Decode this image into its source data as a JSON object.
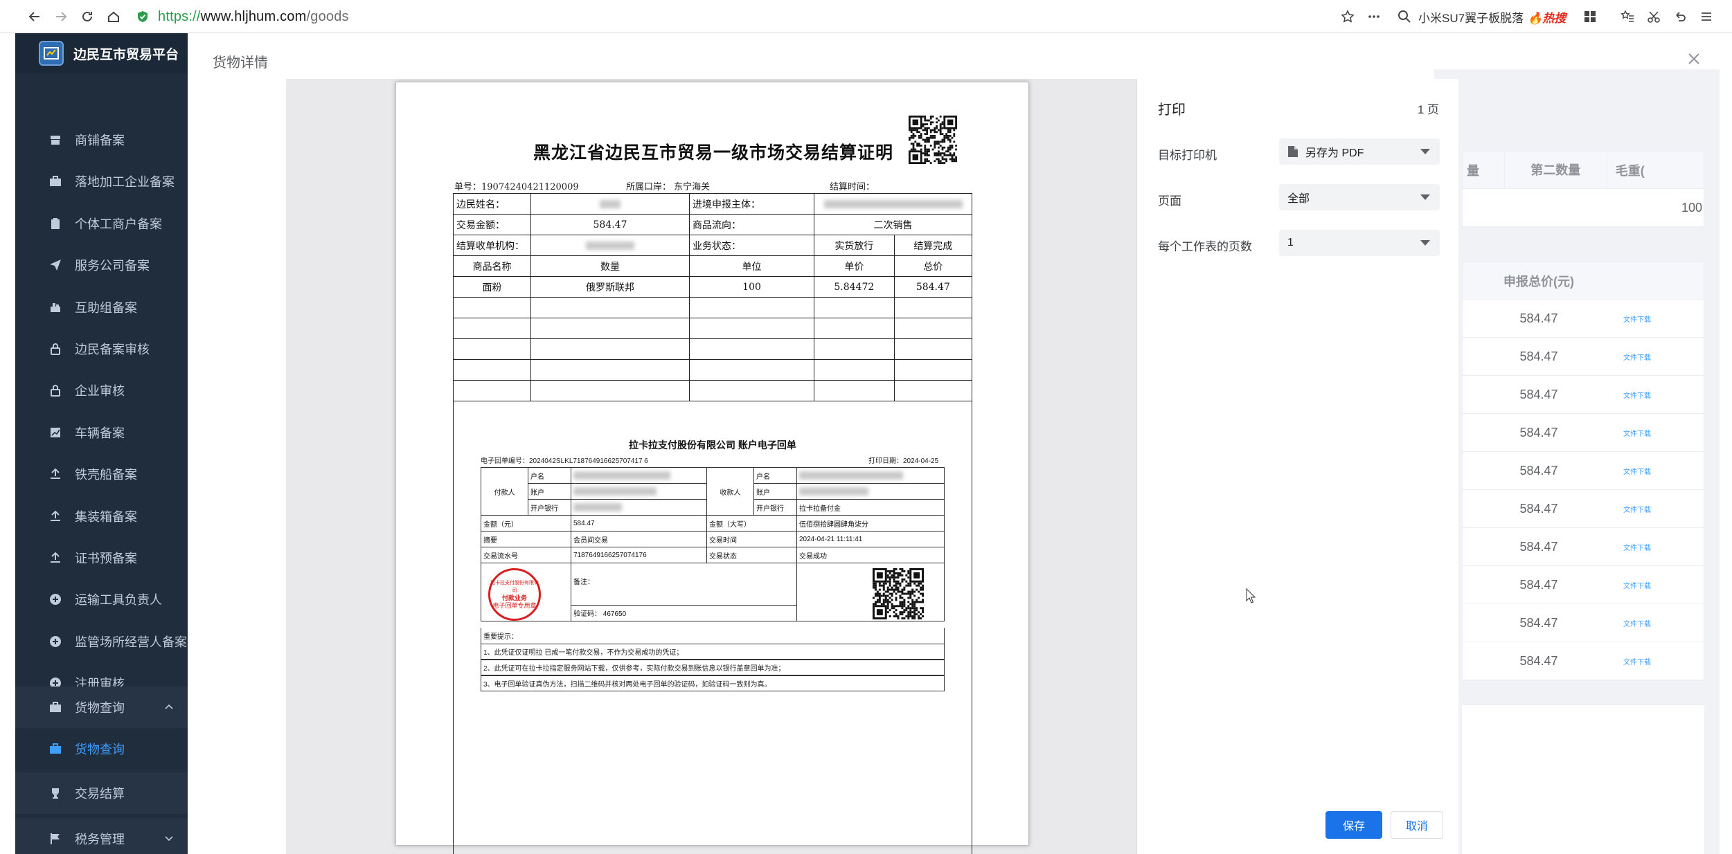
{
  "browser": {
    "url_scheme": "https://",
    "url_host": "www.hljhum.com",
    "url_path": "/goods",
    "search_text": "小米SU7翼子板脱落",
    "search_hot": "热搜"
  },
  "sidebar": {
    "brand": "边民互市贸易平台",
    "items": [
      {
        "label": "商铺备案",
        "icon": "shop-icon"
      },
      {
        "label": "落地加工企业备案",
        "icon": "briefcase-icon"
      },
      {
        "label": "个体工商户备案",
        "icon": "clipboard-icon"
      },
      {
        "label": "服务公司备案",
        "icon": "send-icon"
      },
      {
        "label": "互助组备案",
        "icon": "group-icon"
      },
      {
        "label": "边民备案审核",
        "icon": "lock-icon"
      },
      {
        "label": "企业审核",
        "icon": "lock-icon"
      },
      {
        "label": "车辆备案",
        "icon": "chart-icon"
      },
      {
        "label": "铁壳船备案",
        "icon": "upload-icon"
      },
      {
        "label": "集装箱备案",
        "icon": "upload-icon"
      },
      {
        "label": "证书预备案",
        "icon": "upload-icon"
      },
      {
        "label": "运输工具负责人",
        "icon": "plus-circle-icon"
      },
      {
        "label": "监管场所经营人备案",
        "icon": "plus-circle-icon"
      },
      {
        "label": "注册审核",
        "icon": "plus-circle-icon"
      }
    ],
    "group_goods": "货物查询",
    "sub_goods": "货物查询",
    "trade_settle": "交易结算",
    "tax_manage": "税务管理"
  },
  "main": {
    "title": "货物详情"
  },
  "background_table": {
    "headers": [
      "量",
      "第二数量",
      "毛重("
    ],
    "row1_last": "100",
    "header2": "申报总价(元)",
    "rows": [
      "584.47",
      "584.47",
      "584.47",
      "584.47",
      "584.47",
      "584.47",
      "584.47",
      "584.47",
      "584.47",
      "584.47"
    ],
    "download_label": "文件下载"
  },
  "print_dialog": {
    "title": "打印",
    "page_count": "1 页",
    "printer_label": "目标打印机",
    "printer_value": "另存为 PDF",
    "pages_label": "页面",
    "pages_value": "全部",
    "per_sheet_label": "每个工作表的页数",
    "per_sheet_value": "1",
    "save": "保存",
    "cancel": "取消"
  },
  "document": {
    "title": "黑龙江省边民互市贸易一级市场交易结算证明",
    "serial": "单号：19074240421120009",
    "port": "所属口岸：  东宁海关",
    "settle_time": "结算时间：",
    "r1_a": "边民姓名：",
    "r1_c": "进境申报主体：",
    "r2_a": "交易金额：",
    "r2_b": "584.47",
    "r2_c": "商品流向：",
    "r2_d": "二次销售",
    "r3_a": "结算收单机构：",
    "r3_c": "业务状态：",
    "r3_d": "实货放行",
    "r3_e": "结算完成",
    "head": [
      "商品名称",
      "数量",
      "单位",
      "单价",
      "总价"
    ],
    "item": [
      "面粉",
      "俄罗斯联邦",
      "100",
      "5.84472",
      "584.47"
    ]
  },
  "receipt": {
    "title": "拉卡拉支付股份有限公司  账户电子回单",
    "number": "电子回单编号：2024042SLKL718764916625707417 6",
    "print_date": "打印日期：2024-04-25",
    "payer": "付款人",
    "payee": "收款人",
    "acct_name": "户名",
    "acct_no": "账户",
    "bank": "开户银行",
    "payee_bank": "拉卡拉备付金",
    "amount_label": "金额（元）",
    "amount": "584.47",
    "amount_cn_label": "金额（大写）",
    "amount_cn": "伍佰捌拾肆圆肆角柒分",
    "summary_label": "摘要",
    "summary": "会员间交易",
    "time_label": "交易时间",
    "time": "2024-04-21  11:11:41",
    "flow_label": "交易流水号",
    "flow": "7187649166257074176",
    "status_label": "交易状态",
    "status": "交易成功",
    "stamp_line1": "拉卡拉支付股份有限公司",
    "stamp_line2": "付款业务",
    "stamp_line3": "电子回单专用章",
    "remark": "备注：",
    "verify": "验证码：  467650",
    "notice_title": "重要提示：",
    "notice1": "1、此凭证仅证明拉              已成一笔付款交易，不作为交易成功的凭证；",
    "notice2": "2、此凭证可在拉卡拉指定服务网站下载，仅供参考，实际付款交易到账信息以银行盖章回单为准；",
    "notice3": "3、电子回单验证真伪方法，扫描二维码并核对两处电子回单的验证码，如验证码一致则为真。"
  }
}
